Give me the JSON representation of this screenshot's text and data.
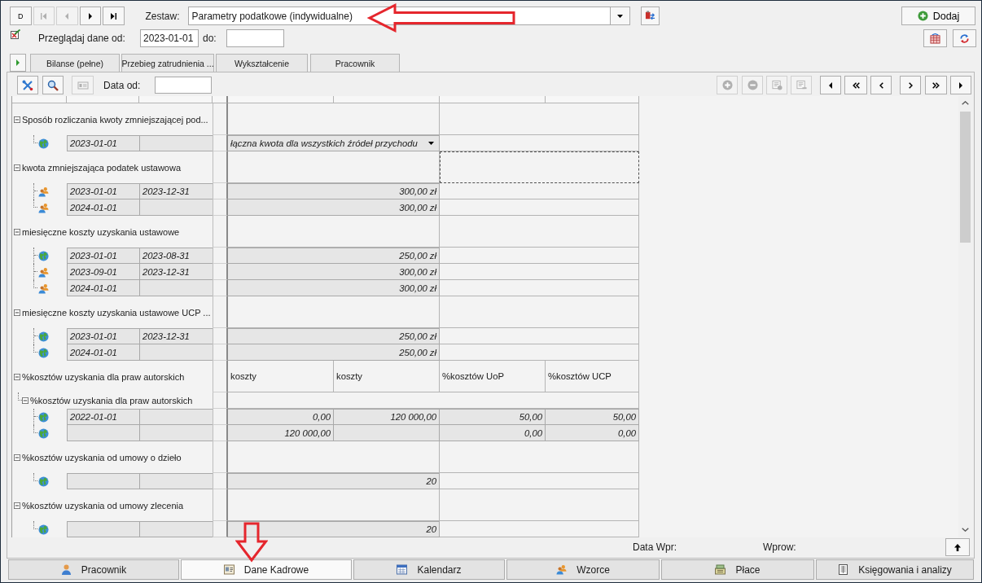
{
  "record_nav": [
    {
      "kind": "text",
      "label": "D",
      "disabled": false
    },
    {
      "kind": "first",
      "disabled": true
    },
    {
      "kind": "prev",
      "disabled": true
    },
    {
      "kind": "next",
      "disabled": false
    },
    {
      "kind": "last",
      "disabled": false
    }
  ],
  "set_selector": {
    "label": "Zestaw:",
    "value": "Parametry podatkowe (indywidualne)"
  },
  "add_button": {
    "label": "Dodaj"
  },
  "date_filter": {
    "label": "Przeglądaj dane od:",
    "from_value": "2023-01-01",
    "to_label": "do:"
  },
  "tabs": [
    {
      "label": "Bilanse (pełne)",
      "selected": false
    },
    {
      "label": "Przebieg zatrudnienia ...",
      "selected": false
    },
    {
      "label": "Wykształcenie",
      "selected": false
    },
    {
      "label": "Pracownik",
      "selected": false
    }
  ],
  "grid_toolbar": {
    "tools": [
      {
        "kind": "tools",
        "disabled": false
      },
      {
        "kind": "search",
        "disabled": false
      },
      {
        "kind": "card",
        "disabled": true
      }
    ],
    "date_label": "Data od:",
    "actions": [
      {
        "kind": "add",
        "disabled": true
      },
      {
        "kind": "remove",
        "disabled": true
      },
      {
        "kind": "insert",
        "disabled": true
      },
      {
        "kind": "delete",
        "disabled": true
      }
    ],
    "navigation": [
      {
        "kind": "first"
      },
      {
        "kind": "pageup"
      },
      {
        "kind": "prev"
      },
      {
        "kind": "next"
      },
      {
        "kind": "pagedown"
      },
      {
        "kind": "last"
      }
    ]
  },
  "grid": {
    "groups": [
      {
        "title": "Sposób rozliczania kwoty zmniejszającej pod...",
        "expanded": true,
        "focused": false,
        "rows": [
          {
            "kind": "globe",
            "date_from": "2023-01-01",
            "cells": [
              {
                "kind": "select",
                "text": "łączna kwota dla wszystkich źródeł przychodu"
              }
            ]
          }
        ]
      },
      {
        "title": "kwota zmniejszająca podatek ustawowa",
        "expanded": true,
        "focused": true,
        "rows": [
          {
            "kind": "people",
            "date_from": "2023-01-01",
            "date_to": "2023-12-31",
            "cells": [
              {
                "kind": "number",
                "text": "300,00 zł"
              }
            ]
          },
          {
            "kind": "people",
            "date_from": "2024-01-01",
            "cells": [
              {
                "kind": "number",
                "text": "300,00 zł"
              }
            ]
          }
        ]
      },
      {
        "title": "miesięczne koszty uzyskania ustawowe",
        "expanded": true,
        "focused": false,
        "rows": [
          {
            "kind": "globe",
            "date_from": "2023-01-01",
            "date_to": "2023-08-31",
            "cells": [
              {
                "kind": "number",
                "text": "250,00 zł"
              }
            ]
          },
          {
            "kind": "people",
            "date_from": "2023-09-01",
            "date_to": "2023-12-31",
            "cells": [
              {
                "kind": "number",
                "text": "300,00 zł"
              }
            ]
          },
          {
            "kind": "people",
            "date_from": "2024-01-01",
            "cells": [
              {
                "kind": "number",
                "text": "300,00 zł"
              }
            ]
          }
        ]
      },
      {
        "title": "miesięczne koszty uzyskania ustawowe UCP ...",
        "expanded": true,
        "focused": false,
        "rows": [
          {
            "kind": "globe",
            "date_from": "2023-01-01",
            "date_to": "2023-12-31",
            "cells": [
              {
                "kind": "number",
                "text": "250,00 zł"
              }
            ]
          },
          {
            "kind": "globe",
            "date_from": "2024-01-01",
            "cells": [
              {
                "kind": "number",
                "text": "250,00 zł"
              }
            ]
          }
        ]
      },
      {
        "title": "%kosztów uzyskania dla praw autorskich",
        "expanded": true,
        "focused": false,
        "column_headers": [
          "koszty",
          "koszty",
          "%kosztów UoP",
          "%kosztów UCP"
        ],
        "children": [
          {
            "title": "%kosztów uzyskania dla praw autorskich",
            "expanded": true,
            "rows": [
              {
                "kind": "globe",
                "date_from": "2022-01-01",
                "cells": [
                  {
                    "kind": "number",
                    "text": "0,00"
                  },
                  {
                    "kind": "number",
                    "text": "120 000,00"
                  },
                  {
                    "kind": "number",
                    "text": "50,00"
                  },
                  {
                    "kind": "number",
                    "text": "50,00"
                  }
                ]
              },
              {
                "kind": "globe",
                "cells": [
                  {
                    "kind": "number",
                    "text": "120 000,00"
                  },
                  {
                    "kind": "blank"
                  },
                  {
                    "kind": "number",
                    "text": "0,00"
                  },
                  {
                    "kind": "number",
                    "text": "0,00"
                  }
                ]
              }
            ]
          }
        ]
      },
      {
        "title": "%kosztów uzyskania od umowy o dzieło",
        "expanded": true,
        "focused": false,
        "rows": [
          {
            "kind": "globe",
            "cells": [
              {
                "kind": "number",
                "text": "20"
              }
            ]
          }
        ]
      },
      {
        "title": "%kosztów uzyskania od umowy zlecenia",
        "expanded": true,
        "focused": false,
        "rows": [
          {
            "kind": "globe",
            "cells": [
              {
                "kind": "number",
                "text": "20"
              }
            ]
          }
        ]
      }
    ]
  },
  "footer": {
    "entry_date_label": "Data Wpr:",
    "entered_by_label": "Wprow:"
  },
  "bottom_tabs": [
    {
      "label": "Pracownik",
      "selected": false
    },
    {
      "label": "Dane Kadrowe",
      "selected": true
    },
    {
      "label": "Kalendarz",
      "selected": false
    },
    {
      "label": "Wzorce",
      "selected": false
    },
    {
      "label": "Płace",
      "selected": false
    },
    {
      "label": "Księgowania i analizy",
      "selected": false
    }
  ]
}
